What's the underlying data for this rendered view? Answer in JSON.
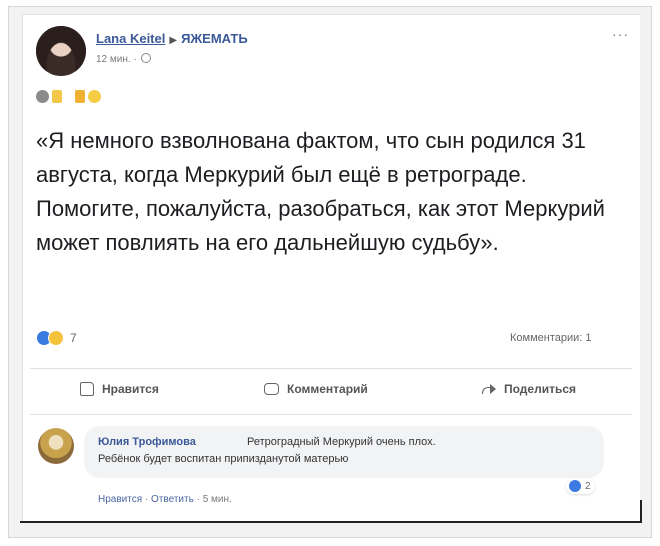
{
  "post": {
    "author": "Lana Keitel",
    "group": "ЯЖЕМАТЬ",
    "time": "12 мин. ·",
    "menu": "···",
    "text": "«Я немного взволнована фактом, что сын родился 31 августа, когда Меркурий был ещё в ретрограде. Помогите, пожалуйста, разобраться, как этот Меркурий может повлиять на его дальнейшую судьбу».",
    "reaction_count": "7",
    "comments_count": "Комментарии: 1"
  },
  "actions": {
    "like": "Нравится",
    "comment": "Комментарий",
    "share": "Поделиться"
  },
  "comment": {
    "author": "Юлия Трофимова",
    "text_line1": "Ретроградный Меркурий очень плох.",
    "text_line2": "Ребёнок будет воспитан припизданутой матерью",
    "like": "Нравится",
    "reply": "Ответить",
    "time": "5 мин.",
    "sep": "·",
    "reactions": "2"
  },
  "colors": {
    "link": "#3b5998",
    "like_badge": "#3b7ae0",
    "haha_badge": "#f5c33b"
  }
}
